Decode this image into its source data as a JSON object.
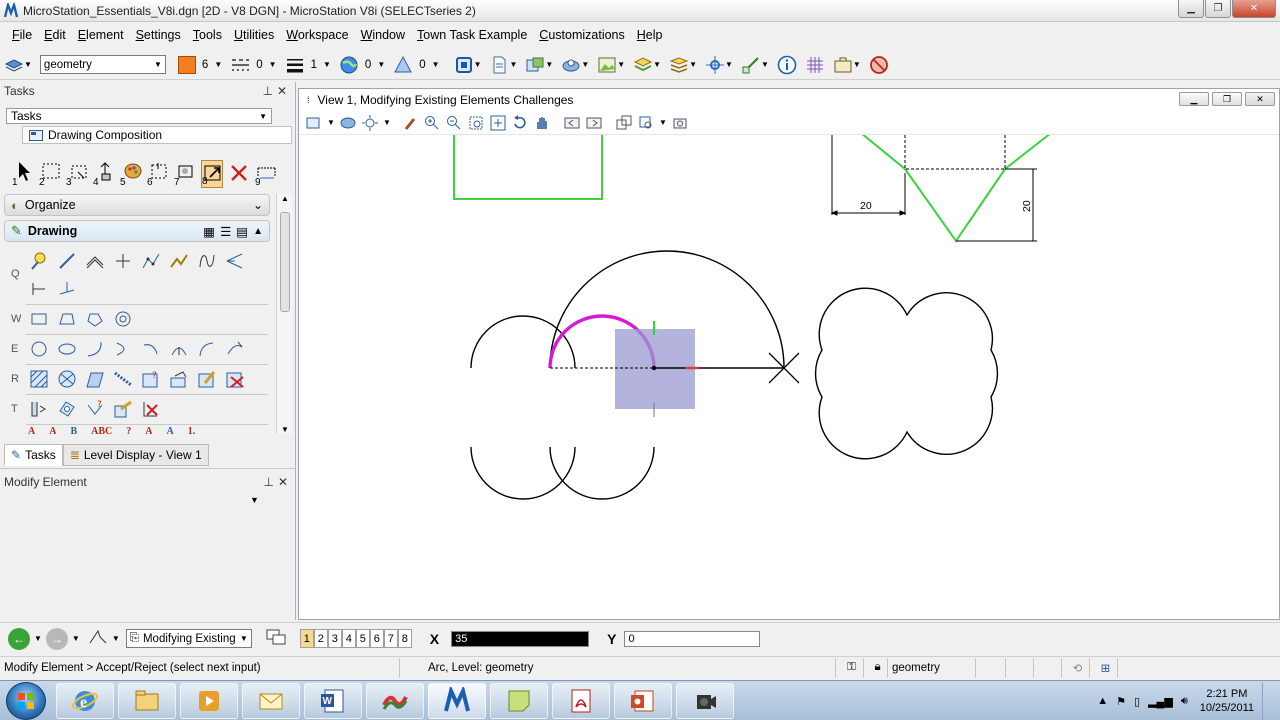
{
  "window": {
    "title": "MicroStation_Essentials_V8i.dgn [2D - V8 DGN] - MicroStation V8i (SELECTseries 2)"
  },
  "menu": [
    "File",
    "Edit",
    "Element",
    "Settings",
    "Tools",
    "Utilities",
    "Workspace",
    "Window",
    "Town Task Example",
    "Customizations",
    "Help"
  ],
  "attributes": {
    "level": "geometry",
    "color": "6",
    "linestyle": "0",
    "weight": "1",
    "transparency": "0",
    "priority": "0",
    "color_hex": "#f47f20"
  },
  "tasks_panel": {
    "title": "Tasks",
    "selected_task": "Tasks",
    "child": "Drawing Composition",
    "numbers": [
      "1",
      "2",
      "3",
      "4",
      "5",
      "6",
      "7",
      "8",
      "9"
    ],
    "organize": "Organize",
    "drawing": "Drawing",
    "row_labels": [
      "Q",
      "W",
      "E",
      "R",
      "T"
    ],
    "text_tools": [
      "A",
      "A",
      "B",
      "ABC",
      "?",
      "A",
      "A",
      "1."
    ],
    "tabs": [
      "Tasks",
      "Level Display - View 1"
    ]
  },
  "modify_panel": {
    "title": "Modify Element"
  },
  "view": {
    "title": "View 1, Modifying Existing Elements Challenges",
    "dimension_20_horizontal": "20",
    "dimension_20_vertical": "20"
  },
  "bottom": {
    "tool_combo": "Modifying Existing",
    "view_numbers": [
      "1",
      "2",
      "3",
      "4",
      "5",
      "6",
      "7",
      "8"
    ],
    "x_label": "X",
    "x_value": "35",
    "y_label": "Y",
    "y_value": "0"
  },
  "status": {
    "prompt": "Modify Element > Accept/Reject (select next input)",
    "info": "Arc, Level: geometry",
    "level": "geometry"
  },
  "taskbar": {
    "time": "2:21 PM",
    "date": "10/25/2011"
  }
}
